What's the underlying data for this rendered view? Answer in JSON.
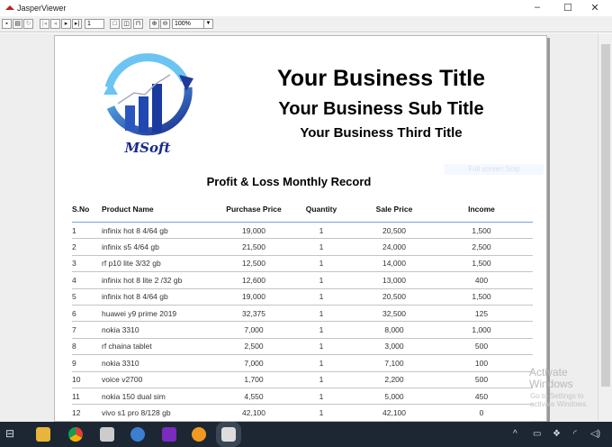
{
  "window": {
    "title": "JasperViewer",
    "controls": [
      "–",
      "☐",
      "✕"
    ]
  },
  "toolbar": {
    "page_number": "1",
    "zoom": "100%"
  },
  "report": {
    "logo_text": "MSoft",
    "title": "Your Business Title",
    "subtitle": "Your Business Sub Title",
    "third_title": "Your Business Third Title",
    "record_title": "Profit & Loss Monthly Record",
    "overlay_hint": "Full screen Snip",
    "columns": [
      "S.No",
      "Product Name",
      "Purchase Price",
      "Quantity",
      "Sale Price",
      "Income"
    ],
    "rows": [
      [
        "1",
        "infinix hot 8 4/64 gb",
        "19,000",
        "1",
        "20,500",
        "1,500"
      ],
      [
        "2",
        "infinix s5 4/64 gb",
        "21,500",
        "1",
        "24,000",
        "2,500"
      ],
      [
        "3",
        "rf p10 lite 3/32 gb",
        "12,500",
        "1",
        "14,000",
        "1,500"
      ],
      [
        "4",
        "infinix hot 8 lite 2 /32 gb",
        "12,600",
        "1",
        "13,000",
        "400"
      ],
      [
        "5",
        "infinix hot 8 4/64 gb",
        "19,000",
        "1",
        "20,500",
        "1,500"
      ],
      [
        "6",
        "huawei y9 prime 2019",
        "32,375",
        "1",
        "32,500",
        "125"
      ],
      [
        "7",
        "nokia 3310",
        "7,000",
        "1",
        "8,000",
        "1,000"
      ],
      [
        "8",
        "rf chaina tablet",
        "2,500",
        "1",
        "3,000",
        "500"
      ],
      [
        "9",
        "nokia 3310",
        "7,000",
        "1",
        "7,100",
        "100"
      ],
      [
        "10",
        "voice v2700",
        "1,700",
        "1",
        "2,200",
        "500"
      ],
      [
        "11",
        "nokia 150 dual sim",
        "4,550",
        "1",
        "5,000",
        "450"
      ],
      [
        "12",
        "vivo s1 pro 8/128 gb",
        "42,100",
        "1",
        "42,100",
        "0"
      ]
    ]
  },
  "watermark": {
    "line1": "Activate Windows",
    "line2": "Go to Settings to activate Windows."
  },
  "taskbar": {
    "apps": [
      "task-view",
      "file-explorer",
      "chrome",
      "video-editor",
      "network-tool",
      "intellij",
      "app-orange",
      "java"
    ]
  }
}
